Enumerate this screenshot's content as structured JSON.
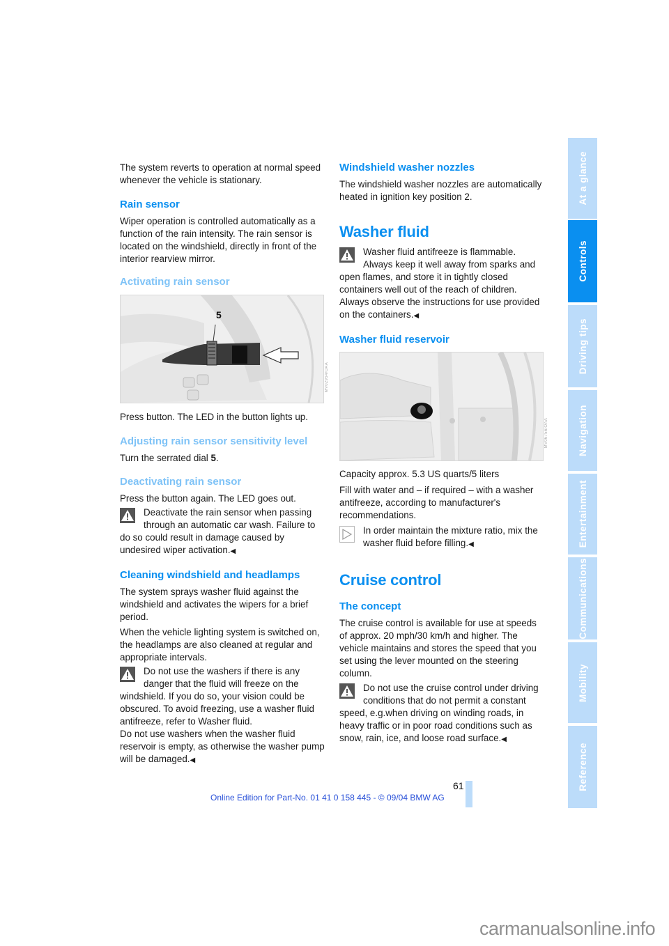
{
  "left_column": {
    "intro_text": "The system reverts to operation at normal speed whenever the vehicle is stationary.",
    "rain_sensor": {
      "heading": "Rain sensor",
      "text": "Wiper operation is controlled automatically as a function of the rain intensity. The rain sensor is located on the windshield, directly in front of the interior rearview mirror."
    },
    "activating": {
      "heading": "Activating rain sensor",
      "figure_label": "5",
      "figure_code": "MV02954/OAA",
      "text": "Press button. The LED in the button lights up."
    },
    "adjusting": {
      "heading": "Adjusting rain sensor sensitivity level",
      "text_prefix": "Turn the serrated dial ",
      "text_bold": "5",
      "text_suffix": "."
    },
    "deactivating": {
      "heading": "Deactivating rain sensor",
      "text": "Press the button again. The LED goes out.",
      "warning": "Deactivate the rain sensor when passing through an automatic car wash. Failure to do so could result in damage caused by undesired wiper activation.",
      "end_mark": "◀"
    },
    "cleaning": {
      "heading": "Cleaning windshield and headlamps",
      "text1": "The system sprays washer fluid against the windshield and activates the wipers for a brief period.",
      "text2": "When the vehicle lighting system is switched on, the headlamps are also cleaned at regular and appropriate intervals.",
      "warning": "Do not use the washers if there is any danger that the fluid will freeze on the windshield. If you do so, your vision could be obscured. To avoid freezing, use a washer fluid antifreeze, refer to Washer fluid.",
      "warning2": "Do not use washers when the washer fluid reservoir is empty, as otherwise the washer pump will be damaged.",
      "end_mark": "◀"
    }
  },
  "right_column": {
    "nozzles": {
      "heading": "Windshield washer nozzles",
      "text": "The windshield washer nozzles are automatically heated in ignition key position 2."
    },
    "washer_fluid": {
      "heading": "Washer fluid",
      "warning": "Washer fluid antifreeze is flammable. Always keep it well away from sparks and open flames, and store it in tightly closed containers well out of the reach of children. Always observe the instructions for use provided on the containers.",
      "end_mark": "◀"
    },
    "reservoir": {
      "heading": "Washer fluid reservoir",
      "figure_code": "MV06756/OAA",
      "capacity": "Capacity approx. 5.3 US quarts/5 liters",
      "text": "Fill with water and – if required – with a washer antifreeze, according to manufacturer's recommendations.",
      "note": "In order maintain the mixture ratio, mix the washer fluid before filling.",
      "end_mark": "◀"
    },
    "cruise": {
      "heading": "Cruise control",
      "subheading": "The concept",
      "text": "The cruise control is available for use at speeds of approx. 20 mph/30 km/h and higher. The vehicle maintains and stores the speed that you set using the lever mounted on the steering column.",
      "warning": "Do not use the cruise control under driving conditions that do not permit a constant speed, e.g.when driving on winding roads, in heavy traffic or in poor road conditions such as snow, rain, ice, and loose road surface.",
      "end_mark": "◀"
    }
  },
  "side_tabs": [
    {
      "label": "At a glance",
      "active": false
    },
    {
      "label": "Controls",
      "active": true
    },
    {
      "label": "Driving tips",
      "active": false
    },
    {
      "label": "Navigation",
      "active": false
    },
    {
      "label": "Entertainment",
      "active": false
    },
    {
      "label": "Communications",
      "active": false
    },
    {
      "label": "Mobility",
      "active": false
    },
    {
      "label": "Reference",
      "active": false
    }
  ],
  "footer": {
    "page_number": "61",
    "edition": "Online Edition for Part-No. 01 41 0 158 445 - © 09/04 BMW AG",
    "watermark": "carmanualsonline.info"
  },
  "colors": {
    "heading_blue": "#0a8ff0",
    "subheading_light_blue": "#7fc3f7",
    "tab_inactive": "#bcdcfa",
    "tab_active": "#0a8ff0",
    "footer_blue": "#2850d8"
  }
}
